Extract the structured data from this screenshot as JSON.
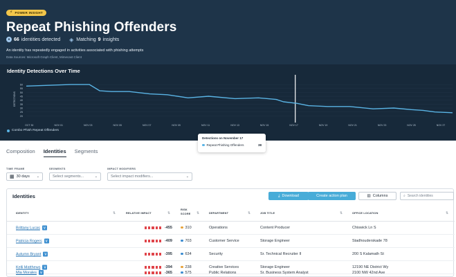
{
  "header": {
    "badge": "POWER INSIGHT",
    "title": "Repeat Phishing Offenders",
    "identities_count": "66",
    "identities_text": "identities detected",
    "matching_prefix": "Matching",
    "matching_count": "9",
    "matching_suffix": "insights",
    "description": "An identity has repeatedly engaged in activities associated with phishing attempts",
    "sources": "Data Sources: Microsoft Graph Client, Mimecast Client"
  },
  "chart_data": {
    "type": "line",
    "title": "Identity Detections Over Time",
    "ylabel": "DETECTIONS",
    "ylim": [
      15,
      68
    ],
    "yticks": [
      20,
      25,
      30,
      35,
      40,
      45,
      50,
      55,
      60
    ],
    "xticks": [
      "OCT 30",
      "NOV 01",
      "NOV 03",
      "NOV 05",
      "NOV 07",
      "NOV 09",
      "NOV 11",
      "NOV 13",
      "NOV 15",
      "NOV 17",
      "NOV 19",
      "NOV 21",
      "NOV 23",
      "NOV 25",
      "NOV 27"
    ],
    "x": [
      0,
      1.5,
      3,
      4.3,
      5,
      5.8,
      7,
      8.4,
      9.6,
      11,
      12.4,
      14.2,
      15.8,
      17,
      17.5,
      18.4,
      19.2,
      20.5,
      22,
      23.6,
      25,
      26.2,
      27,
      27.8,
      29
    ],
    "series": [
      {
        "name": "Combo Phish Repeat Offenders",
        "values": [
          58,
          59,
          60,
          60,
          52,
          51,
          51,
          48,
          47,
          43,
          45,
          42,
          43,
          41,
          38,
          36,
          33,
          32,
          32,
          29,
          30,
          28,
          27,
          25,
          24
        ]
      }
    ],
    "legend": "bottom-left",
    "highlight": {
      "x_label": "NOV 17"
    }
  },
  "tooltip": {
    "title": "Detections on November 17",
    "series": "Repeat Phishing Offenders",
    "value": "38"
  },
  "tabs": [
    {
      "label": "Composition"
    },
    {
      "label": "Identities"
    },
    {
      "label": "Segments"
    }
  ],
  "filters": {
    "time_label": "TIME FRAME",
    "time_value": "30 days",
    "segments_label": "SEGMENTS",
    "segments_placeholder": "Select segments...",
    "impact_label": "IMPACT MODIFIERS",
    "impact_placeholder": "Select impact modifiers..."
  },
  "identities": {
    "title": "Identities",
    "download_label": "Download",
    "action_label": "Create action plan",
    "columns_label": "Columns",
    "search_placeholder": "Search identities",
    "columns": {
      "identity": "IDENTITY",
      "impact": "RELATIVE IMPACT",
      "risk_1": "RISK",
      "risk_2": "SCORE",
      "department": "DEPARTMENT",
      "job": "JOB TITLE",
      "office": "OFFICE LOCATION"
    },
    "rows": [
      {
        "name": "Brittany Lucas",
        "badge": "V",
        "impact": "-455",
        "risk": "310",
        "risk_color": "#e8a33b",
        "department": "Operations",
        "job": "Content Producer",
        "office": "Chiswick Ln S"
      },
      {
        "name": "Patricia Rogers",
        "badge": "V",
        "impact": "-409",
        "risk": "703",
        "risk_color": "#3b8bd0",
        "department": "Customer Service",
        "job": "Storage Engineer",
        "office": "Stadhouderskade 78"
      },
      {
        "name": "Autumn Bryant",
        "badge": "V",
        "impact": "-395",
        "risk": "634",
        "risk_color": "#3b8bd0",
        "department": "Security",
        "job": "Sr. Technical Recruiter II",
        "office": "200 S Kalamath St"
      },
      {
        "name": "Kelli Matthews",
        "badge": "V",
        "impact": "-394",
        "risk": "238",
        "risk_color": "#e8a33b",
        "department": "Creative Services",
        "job": "Storage Engineer",
        "office": "12190 NE District Wy"
      },
      {
        "name": "Mia Morales",
        "badge": "V",
        "impact": "-365",
        "risk": "575",
        "risk_color": "#3b8bd0",
        "department": "Public Relations",
        "job": "Sr. Business System Analyst",
        "office": "2100 NW 42nd Ave"
      }
    ]
  }
}
